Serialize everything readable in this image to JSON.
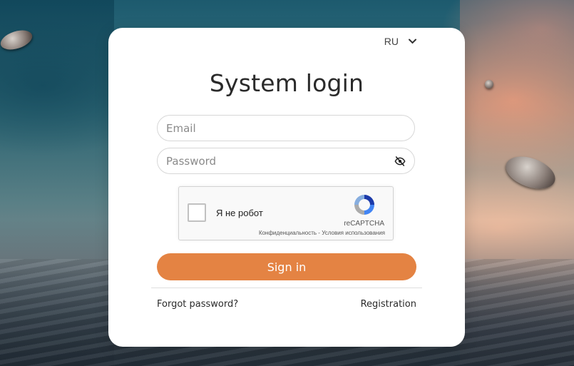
{
  "language": {
    "selected": "RU"
  },
  "title": "System login",
  "email_field": {
    "placeholder": "Email",
    "value": ""
  },
  "password_field": {
    "placeholder": "Password",
    "value": ""
  },
  "captcha": {
    "label": "Я не робот",
    "brand": "reCAPTCHA",
    "links": "Конфиденциальность - Условия использования"
  },
  "signin_button": "Sign in",
  "links": {
    "forgot_password": "Forgot password?",
    "registration": "Registration"
  },
  "colors": {
    "accent": "#e48343",
    "card_bg": "#ffffff",
    "text": "#2a2a2a"
  },
  "icons": {
    "password_toggle": "eye-off-icon",
    "language_dropdown": "chevron-down-icon",
    "captcha_logo": "recaptcha-icon"
  }
}
